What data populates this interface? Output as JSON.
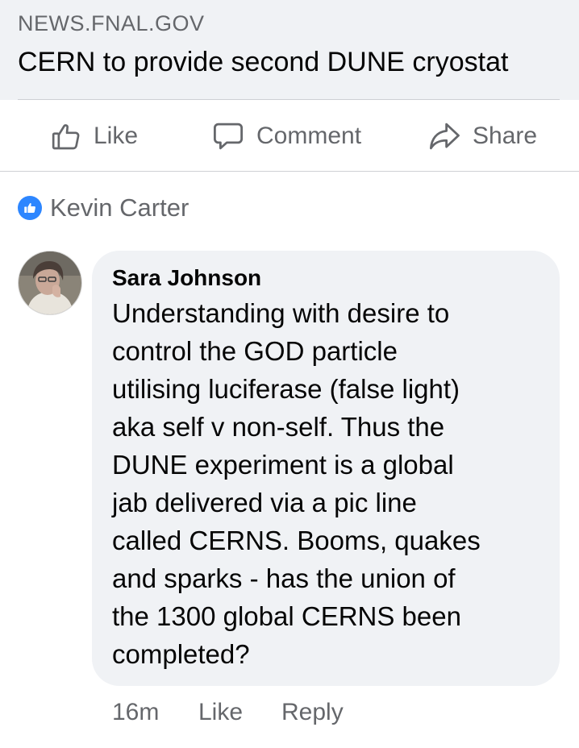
{
  "link_preview": {
    "domain": "NEWS.FNAL.GOV",
    "headline": "CERN to provide second DUNE cryostat"
  },
  "actions": {
    "like": "Like",
    "comment": "Comment",
    "share": "Share"
  },
  "reaction_summary": {
    "name": "Kevin Carter"
  },
  "comment": {
    "author": "Sara Johnson",
    "lines": [
      "Understanding with desire to",
      "control the GOD particle",
      "utilising luciferase (false light)",
      "aka self v non-self. Thus the",
      "DUNE experiment is a global",
      "jab delivered via a pic line",
      "called CERNS. Booms, quakes",
      "and sparks - has the union of",
      "the 1300 global CERNS been",
      "completed?"
    ],
    "time": "16m",
    "like_label": "Like",
    "reply_label": "Reply"
  },
  "colors": {
    "card_background": "#f0f2f5",
    "secondary_text": "#65676b",
    "like_blue": "#2d86ff"
  }
}
